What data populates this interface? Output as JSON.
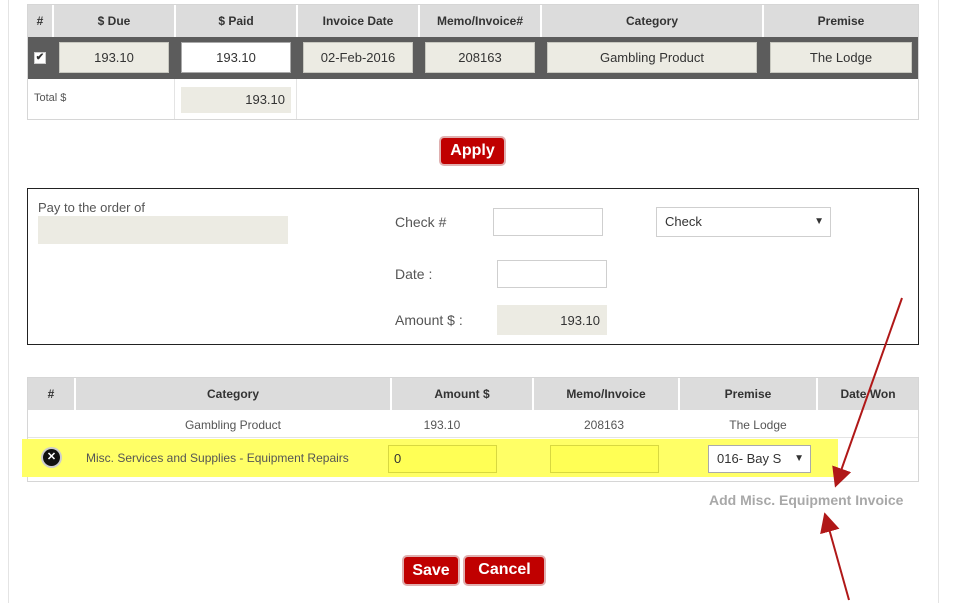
{
  "invoice_table": {
    "headers": [
      "#",
      "$ Due",
      "$ Paid",
      "Invoice Date",
      "Memo/Invoice#",
      "Category",
      "Premise"
    ],
    "row": {
      "checked": true,
      "due": "193.10",
      "paid": "193.10",
      "invoice_date": "02-Feb-2016",
      "memo": "208163",
      "category": "Gambling Product",
      "premise": "The Lodge"
    },
    "total_label": "Total $",
    "total_value": "193.10"
  },
  "apply_label": "Apply",
  "payment": {
    "pay_to_label": "Pay to the order of",
    "pay_to_value": "",
    "check_label": "Check #",
    "check_value": "",
    "method_value": "Check",
    "date_label": "Date :",
    "date_value": "",
    "amount_label": "Amount $ :",
    "amount_value": "193.10"
  },
  "allocation_table": {
    "headers": [
      "#",
      "Category",
      "Amount $",
      "Memo/Invoice",
      "Premise",
      "Date Won"
    ],
    "rows": [
      {
        "category": "Gambling Product",
        "amount": "193.10",
        "memo": "208163",
        "premise": "The Lodge"
      }
    ],
    "new_row": {
      "category": "Misc. Services and Supplies - Equipment Repairs",
      "amount": "0",
      "memo": "",
      "premise": "016- Bay S"
    }
  },
  "add_link": "Add Misc. Equipment Invoice",
  "save_label": "Save",
  "cancel_label": "Cancel",
  "colors": {
    "accent_red": "#c00000",
    "highlight": "#ffff66",
    "arrow": "#b01818"
  }
}
